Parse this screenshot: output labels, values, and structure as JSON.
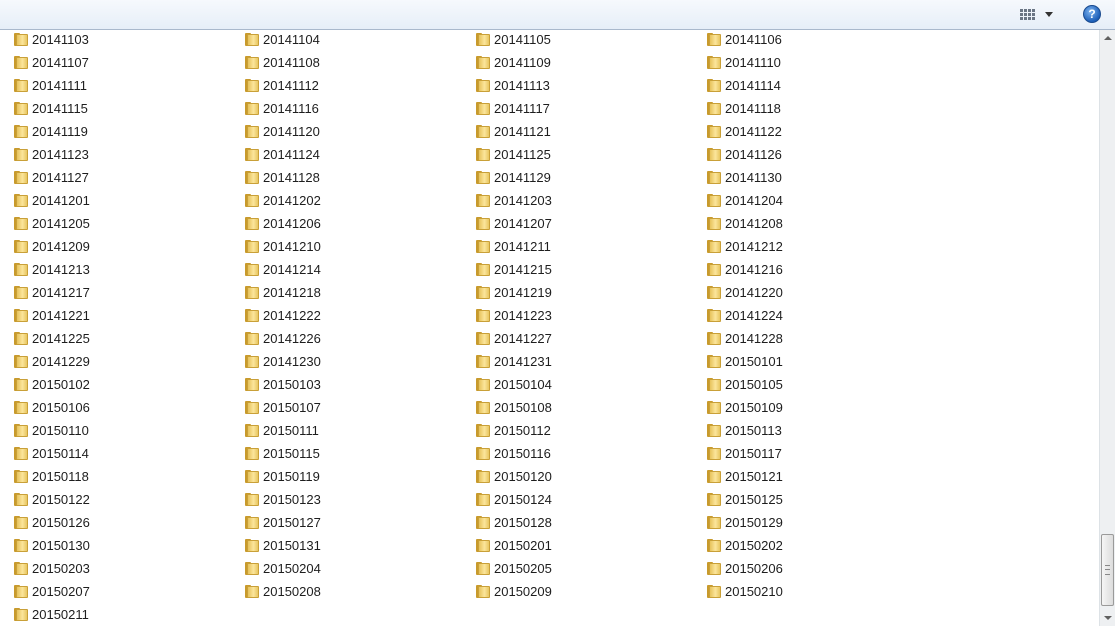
{
  "toolbar": {
    "views_icon": "view-grid-icon",
    "views_dropdown_icon": "chevron-down-icon",
    "help_label": "?"
  },
  "folder_icon": "folder-icon",
  "items": [
    "20141103",
    "20141104",
    "20141105",
    "20141106",
    "20141107",
    "20141108",
    "20141109",
    "20141110",
    "20141111",
    "20141112",
    "20141113",
    "20141114",
    "20141115",
    "20141116",
    "20141117",
    "20141118",
    "20141119",
    "20141120",
    "20141121",
    "20141122",
    "20141123",
    "20141124",
    "20141125",
    "20141126",
    "20141127",
    "20141128",
    "20141129",
    "20141130",
    "20141201",
    "20141202",
    "20141203",
    "20141204",
    "20141205",
    "20141206",
    "20141207",
    "20141208",
    "20141209",
    "20141210",
    "20141211",
    "20141212",
    "20141213",
    "20141214",
    "20141215",
    "20141216",
    "20141217",
    "20141218",
    "20141219",
    "20141220",
    "20141221",
    "20141222",
    "20141223",
    "20141224",
    "20141225",
    "20141226",
    "20141227",
    "20141228",
    "20141229",
    "20141230",
    "20141231",
    "20150101",
    "20150102",
    "20150103",
    "20150104",
    "20150105",
    "20150106",
    "20150107",
    "20150108",
    "20150109",
    "20150110",
    "20150111",
    "20150112",
    "20150113",
    "20150114",
    "20150115",
    "20150116",
    "20150117",
    "20150118",
    "20150119",
    "20150120",
    "20150121",
    "20150122",
    "20150123",
    "20150124",
    "20150125",
    "20150126",
    "20150127",
    "20150128",
    "20150129",
    "20150130",
    "20150131",
    "20150201",
    "20150202",
    "20150203",
    "20150204",
    "20150205",
    "20150206",
    "20150207",
    "20150208",
    "20150209",
    "20150210",
    "20150211"
  ]
}
